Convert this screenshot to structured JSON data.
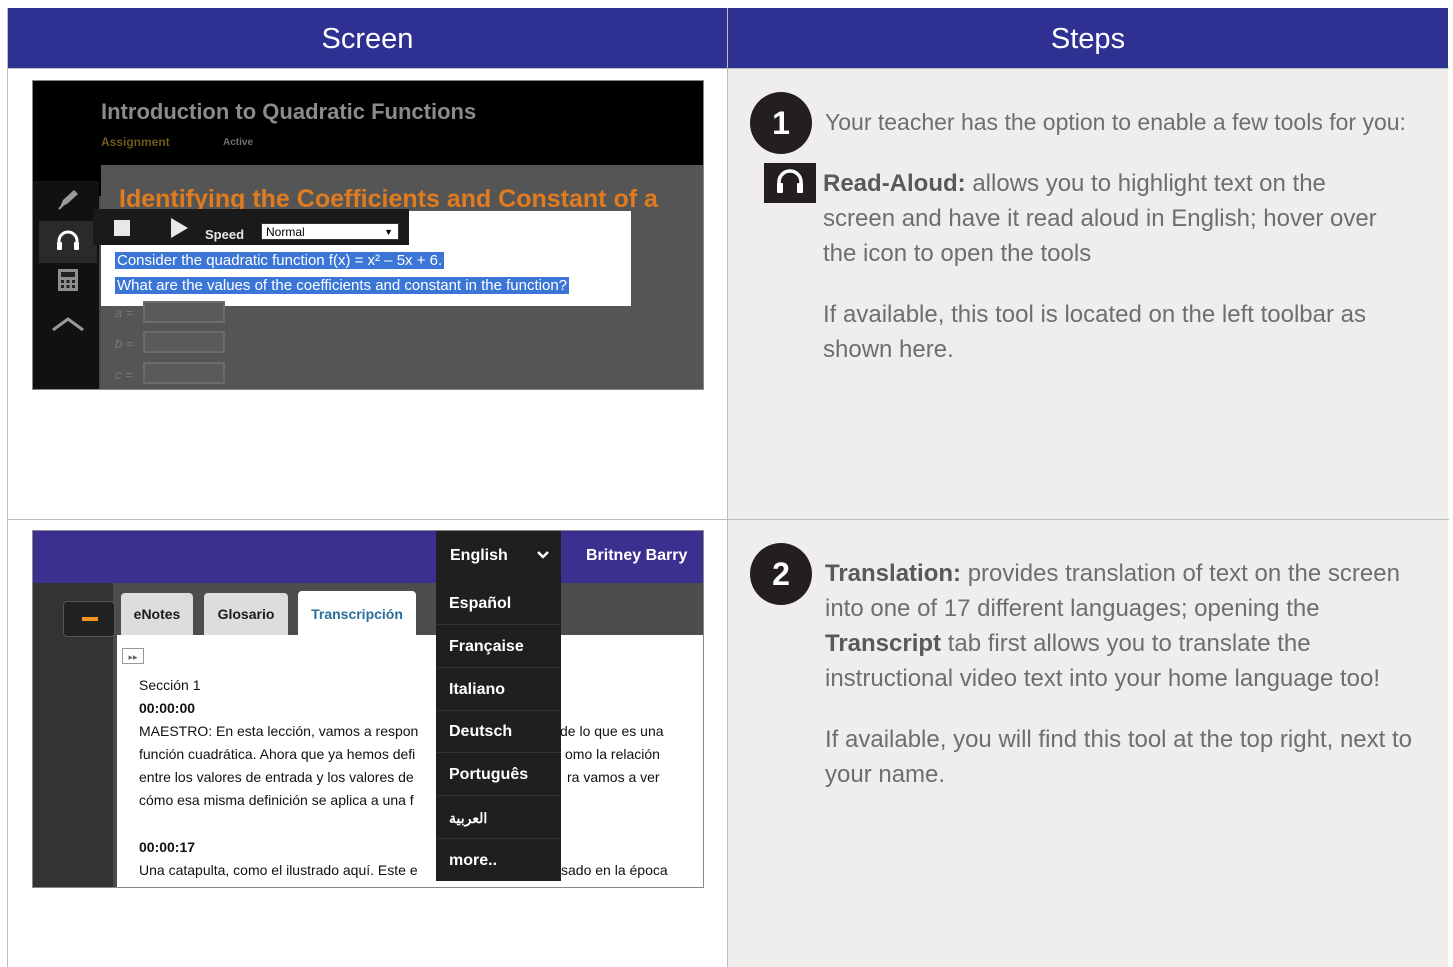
{
  "header": {
    "screen_label": "Screen",
    "steps_label": "Steps"
  },
  "row1": {
    "screenshot": {
      "course_title": "Introduction to Quadratic Functions",
      "tag_assignment": "Assignment",
      "tag_active": "Active",
      "lesson_heading": "Identifying the Coefficients and Constant of a",
      "speed_label": "Speed",
      "speed_value": "Normal",
      "line1": "Consider the quadratic function f(x) = x² – 5x + 6.",
      "line2": "What are the values of the coefficients and constant in the function?",
      "var_a": "a =",
      "var_b": "b =",
      "var_c": "c ="
    },
    "step": {
      "number": "1",
      "intro": "Your teacher has the option to enable a few tools for you:",
      "tool_name": "Read-Aloud:",
      "tool_desc": "allows you to highlight text on the screen and have it read aloud in English; hover over the icon to open the tools",
      "location": "If available, this tool is located on the left toolbar as shown here.",
      "icon": "headphones-icon"
    }
  },
  "row2": {
    "screenshot": {
      "language_selected": "English",
      "user_name": "Britney Barry",
      "tabs": [
        "eNotes",
        "Glosario",
        "Transcripción"
      ],
      "languages": [
        "Español",
        "Française",
        "Italiano",
        "Deutsch",
        "Português",
        "العربية",
        "more.."
      ],
      "section": "Sección 1",
      "ts1": "00:00:00",
      "p1": [
        "MAESTRO: En esta lección, vamos a respon",
        "función cuadrática. Ahora que ya hemos defi",
        "entre los valores de entrada y los valores de",
        "cómo esa misma definición se aplica a una f"
      ],
      "p1_right": [
        "de lo que es una",
        "omo la relación",
        "ra vamos a ver"
      ],
      "ts2": "00:00:17",
      "p2": "Una catapulta, como el ilustrado aquí. Este e",
      "p2_right": "sado en la época"
    },
    "step": {
      "number": "2",
      "tool_name": "Translation:",
      "desc_a": "provides translation of text on the screen into one of 17 different languages; opening the",
      "transcript_word": "Transcript",
      "desc_b": "tab first allows you to translate the instructional video text into your home language too!",
      "location": "If available, you will find this tool at the top right, next to your name."
    }
  },
  "colors": {
    "header_bg": "#2e3192",
    "steps_bg": "#efeeed",
    "accent_orange": "#e07b1f",
    "highlight_blue": "#3b76d6",
    "purple_bar": "#3b2f8f"
  }
}
